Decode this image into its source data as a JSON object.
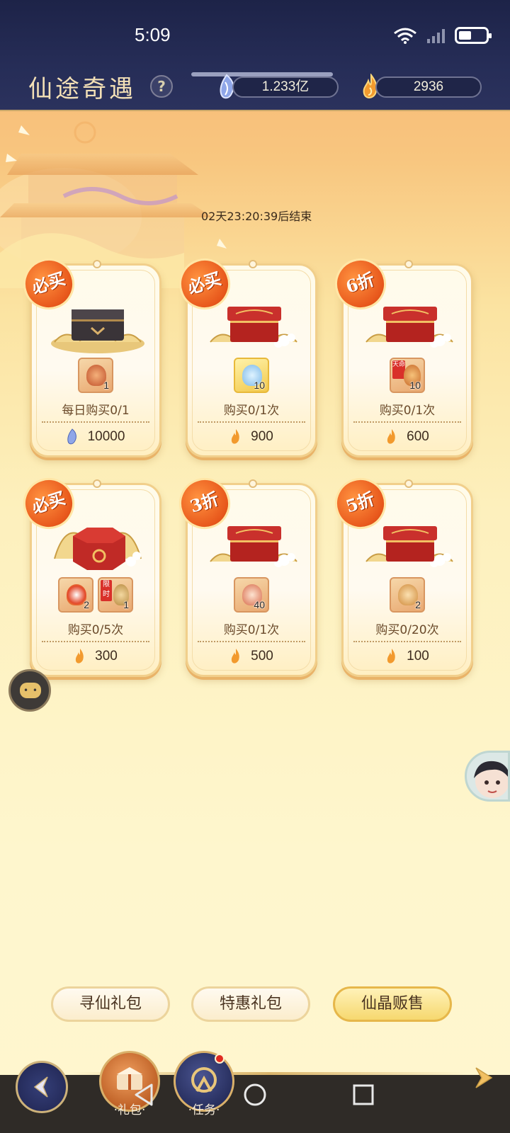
{
  "status_bar": {
    "time": "5:09"
  },
  "header": {
    "title": "仙途奇遇",
    "help_label": "?",
    "currencies": [
      {
        "icon": "spirit-stone-icon",
        "amount": "1.233亿"
      },
      {
        "icon": "fire-crystal-icon",
        "amount": "2936"
      }
    ]
  },
  "event": {
    "timer_text": "02天23:20:39后结束"
  },
  "cards": [
    {
      "badge": "必买",
      "box": "black-chest",
      "items": [
        {
          "qty": "1",
          "tag": ""
        }
      ],
      "limit": "每日购买0/1",
      "currency": "spirit-stone-icon",
      "price": "10000"
    },
    {
      "badge": "必买",
      "box": "red-chest",
      "items": [
        {
          "qty": "10",
          "tag": "",
          "gold": true
        }
      ],
      "limit": "购买0/1次",
      "currency": "fire-crystal-icon",
      "price": "900"
    },
    {
      "badge": "6折",
      "box": "red-chest",
      "items": [
        {
          "qty": "10",
          "tag": "天命"
        }
      ],
      "limit": "购买0/1次",
      "currency": "fire-crystal-icon",
      "price": "600"
    },
    {
      "badge": "必买",
      "box": "hex-chest",
      "items": [
        {
          "qty": "2",
          "tag": ""
        },
        {
          "qty": "1",
          "tag": "限时"
        }
      ],
      "limit": "购买0/5次",
      "currency": "fire-crystal-icon",
      "price": "300"
    },
    {
      "badge": "3折",
      "box": "red-chest",
      "items": [
        {
          "qty": "40",
          "tag": ""
        }
      ],
      "limit": "购买0/1次",
      "currency": "fire-crystal-icon",
      "price": "500"
    },
    {
      "badge": "5折",
      "box": "red-chest",
      "items": [
        {
          "qty": "2",
          "tag": ""
        }
      ],
      "limit": "购买0/20次",
      "currency": "fire-crystal-icon",
      "price": "100"
    }
  ],
  "tabs": [
    {
      "label": "寻仙礼包",
      "active": false
    },
    {
      "label": "特惠礼包",
      "active": false
    },
    {
      "label": "仙晶贩售",
      "active": true
    }
  ],
  "bottom_nav": {
    "gift_label": "·礼包·",
    "task_label": "·任务·"
  },
  "colors": {
    "accent": "#e8581c",
    "header_bg": "#262d57",
    "tab_active": "#f6d86f"
  }
}
